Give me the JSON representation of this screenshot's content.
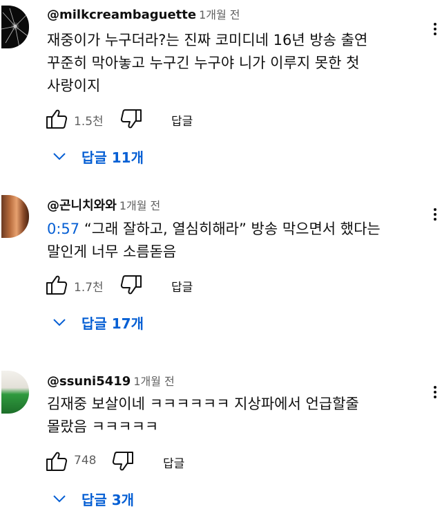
{
  "comments": [
    {
      "author": "@milkcreambaguette",
      "time": "1개월 전",
      "timestamp": "",
      "lines": [
        "재중이가 누구더라?는 진짜 코미디네 16년 방송 출연",
        "꾸준히 막아놓고 누구긴 누구야 니가 이루지 못한 첫",
        "사랑이지"
      ],
      "likes": "1.5천",
      "reply_label": "답글",
      "replies_label": "답글 11개"
    },
    {
      "author": "@곤니치와와",
      "time": "1개월 전",
      "timestamp": "0:57",
      "lines": [
        "“그래 잘하고, 열심히해라” 방송 막으면서 했다는",
        "말인게 너무 소름돋음"
      ],
      "likes": "1.7천",
      "reply_label": "답글",
      "replies_label": "답글 17개"
    },
    {
      "author": "@ssuni5419",
      "time": "1개월 전",
      "timestamp": "",
      "lines": [
        "김재중 보살이네 ㅋㅋㅋㅋㅋㅋ 지상파에서 언급할줄",
        "몰랐음 ㅋㅋㅋㅋㅋ"
      ],
      "likes": "748",
      "reply_label": "답글",
      "replies_label": "답글 3개"
    }
  ],
  "colors": {
    "link": "#065fd4",
    "text": "#0f0f0f",
    "secondary": "#606060"
  },
  "icons": [
    "like-icon",
    "dislike-icon",
    "chevron-down-icon",
    "more-vert-icon"
  ]
}
